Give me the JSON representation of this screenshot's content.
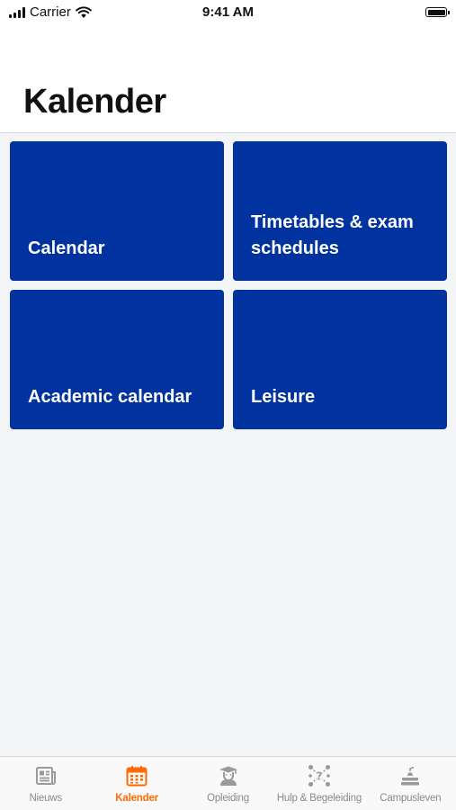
{
  "status_bar": {
    "carrier": "Carrier",
    "time": "9:41 AM"
  },
  "header": {
    "title": "Kalender"
  },
  "tiles": [
    {
      "label": "Calendar"
    },
    {
      "label": "Timetables & exam schedules"
    },
    {
      "label": "Academic calendar"
    },
    {
      "label": "Leisure"
    }
  ],
  "tab_bar": {
    "tabs": [
      {
        "label": "Nieuws",
        "icon": "newspaper-icon",
        "active": false
      },
      {
        "label": "Kalender",
        "icon": "calendar-icon",
        "active": true
      },
      {
        "label": "Opleiding",
        "icon": "graduate-icon",
        "active": false
      },
      {
        "label": "Hulp & Begeleiding",
        "icon": "help-network-icon",
        "active": false
      },
      {
        "label": "Campusleven",
        "icon": "campus-life-icon",
        "active": false
      }
    ]
  },
  "colors": {
    "tile_background": "#0033a0",
    "active_tab": "#ff6a00",
    "inactive_tab": "#8a8a8a",
    "content_background": "#f4f5f7"
  }
}
